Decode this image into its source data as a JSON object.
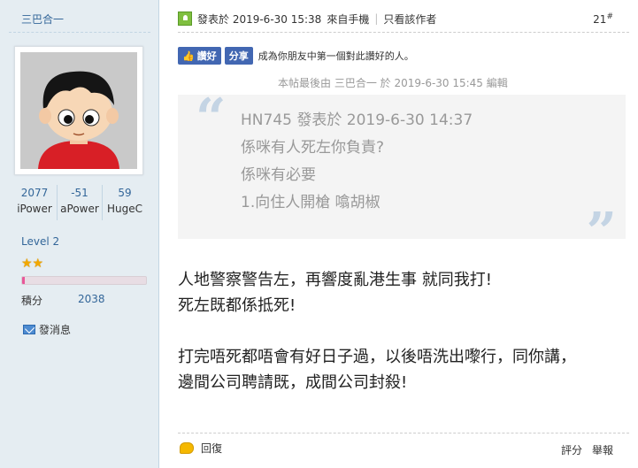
{
  "user": {
    "name": "三巴合一",
    "stats": [
      {
        "value": "2077",
        "label": "iPower"
      },
      {
        "value": "-51",
        "label": "aPower"
      },
      {
        "value": "59",
        "label": "HugeC"
      }
    ],
    "level": "Level 2",
    "stars": "★★",
    "progress_fraction": 0.02,
    "credits_label": "積分",
    "credits_value": "2038",
    "pm_label": "發消息"
  },
  "post": {
    "posted_label": "發表於 2019-6-30 15:38",
    "source": "來自手機",
    "author_only": "只看該作者",
    "floor_number": "21",
    "floor_symbol": "#",
    "fb_like": "讚好",
    "fb_share": "分享",
    "fb_text": "成為你朋友中第一個對此讚好的人。",
    "edit_note": "本帖最後由 三巴合一 於 2019-6-30 15:45 編輯",
    "quote": {
      "open_mark": "“",
      "close_mark": "”",
      "lines": [
        "HN745 發表於 2019-6-30 14:37",
        "係咪有人死左你負責?",
        "係咪有必要",
        "1.向住人開槍 噏胡椒"
      ]
    },
    "body": [
      "人地警察警告左，再響度亂港生事 就同我打!",
      "死左既都係抵死!",
      "",
      "打完唔死都唔會有好日子過，以後唔洗出嚟行，同你講，",
      "邊間公司聘請既，成間公司封殺!"
    ],
    "reply_label": "回復",
    "rate_label": "評分",
    "report_label": "舉報"
  }
}
